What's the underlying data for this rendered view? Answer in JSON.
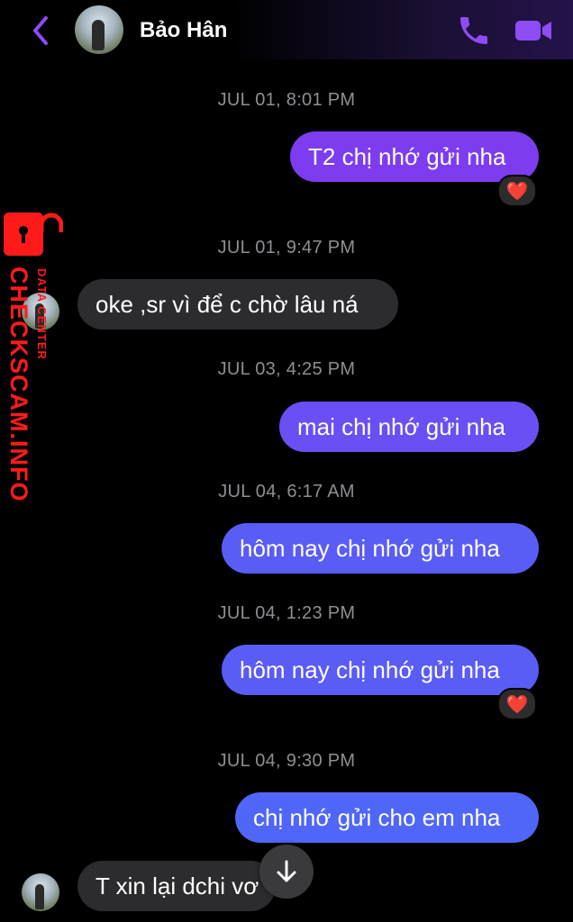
{
  "header": {
    "contact_name": "Bảo Hân",
    "accent_color": "#8e4cf5",
    "icons": [
      "chevron-left-icon",
      "phone-icon",
      "video-camera-icon"
    ]
  },
  "messages": [
    {
      "timestamp": "JUL 01, 8:01 PM",
      "direction": "outgoing",
      "text": "T2 chị nhớ gửi nha",
      "reaction": "❤️"
    },
    {
      "timestamp": "JUL 01, 9:47 PM",
      "direction": "incoming",
      "text": "oke ,sr vì để c chờ lâu ná"
    },
    {
      "timestamp": "JUL 03, 4:25 PM",
      "direction": "outgoing",
      "text": "mai chị nhớ gửi nha"
    },
    {
      "timestamp": "JUL 04, 6:17 AM",
      "direction": "outgoing",
      "text": "hôm nay chị nhớ gửi nha"
    },
    {
      "timestamp": "JUL 04, 1:23 PM",
      "direction": "outgoing",
      "text": "hôm nay chị nhớ gửi nha",
      "reaction": "❤️"
    },
    {
      "timestamp": "JUL 04, 9:30 PM",
      "direction": "outgoing",
      "text": "chị nhớ gửi cho em nha"
    },
    {
      "direction": "incoming",
      "text": "T xin lại dchi vơ"
    }
  ],
  "watermark": {
    "main": "CHECKSCAM.INFO",
    "sub": "DATA CENTER",
    "color": "#ff1a1a"
  },
  "colors": {
    "outgoing_bubble_top": "#7d3cf0",
    "outgoing_bubble_bottom": "#4f66f8",
    "incoming_bubble": "#2c2c2e",
    "timestamp": "#8e8e93"
  }
}
